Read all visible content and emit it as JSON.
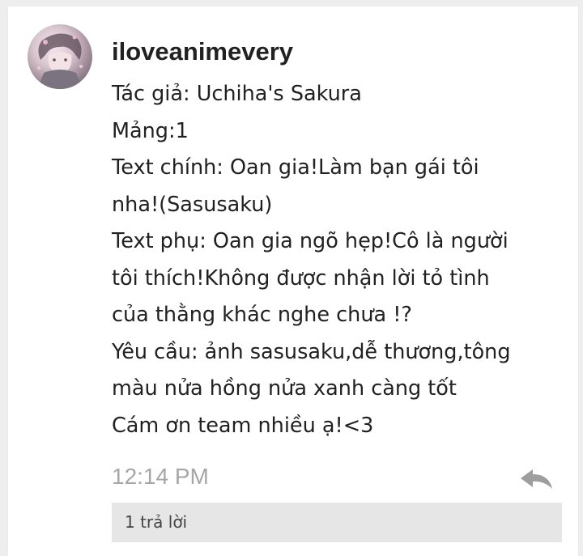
{
  "comment": {
    "avatar_icon": "user-avatar-anime-girl",
    "username": "iloveanimevery",
    "lines": [
      "Tác giả: Uchiha's Sakura",
      "Mảng:1",
      "Text chính: Oan gia!Làm bạn gái tôi",
      "nha!(Sasusaku)",
      "Text phụ: Oan gia ngõ hẹp!Cô là người",
      "tôi thích!Không được nhận lời tỏ tình",
      "của thằng khác nghe chưa !?",
      "Yêu cầu: ảnh sasusaku,dễ thương,tông",
      "màu nửa hồng nửa xanh càng tốt",
      "Cám ơn team nhiều ạ!<3"
    ],
    "timestamp": "12:14 PM",
    "reply_icon": "reply-arrow-icon",
    "replies_label": "1 trả lời"
  },
  "colors": {
    "background": "#eeeeee",
    "card": "#ffffff",
    "text": "#212121",
    "timestamp": "#a6a6a6",
    "reply_icon": "#9e9e9e",
    "replies_bar": "#e6e6e6"
  }
}
